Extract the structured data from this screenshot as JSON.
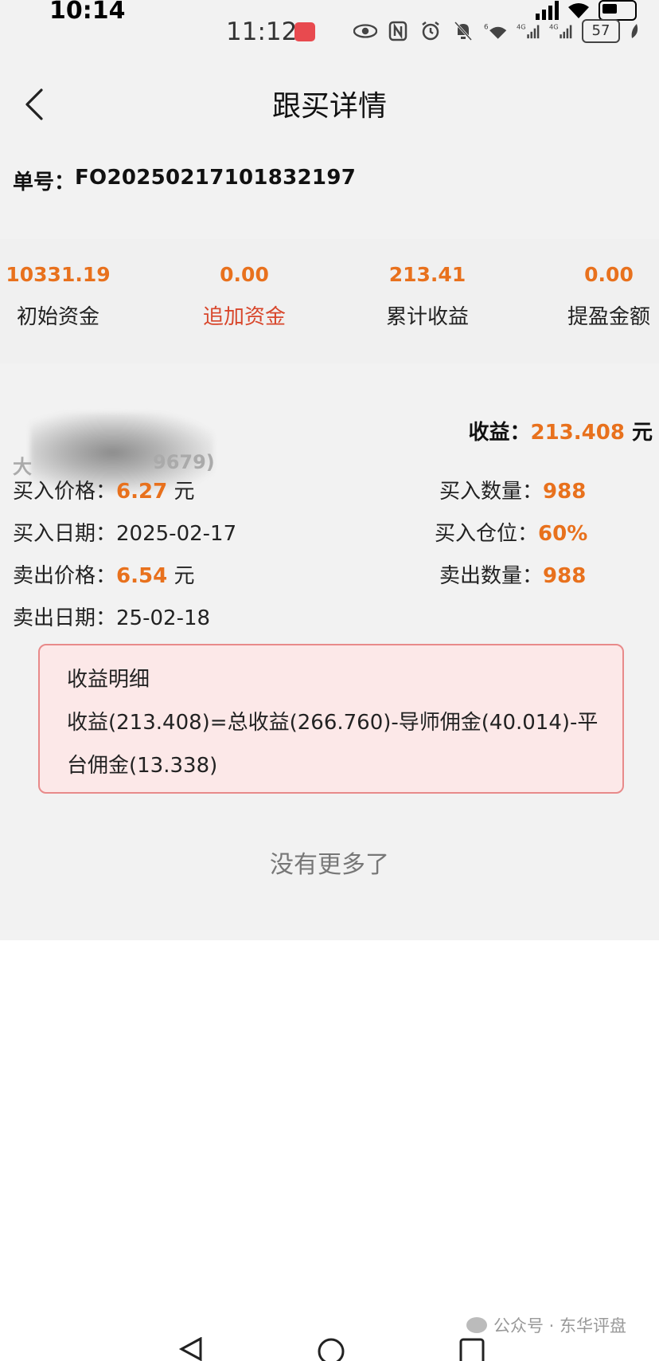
{
  "status_outer": {
    "time": "10:14"
  },
  "status_inner": {
    "time": "11:12",
    "battery": "57",
    "net1": "4G",
    "net2": "4G",
    "wifi_num": "6"
  },
  "header": {
    "title": "跟买详情"
  },
  "order": {
    "label": "单号：",
    "number": "FO20250217101832197"
  },
  "summary": [
    {
      "value": "10331.19",
      "label": "初始资金"
    },
    {
      "value": "0.00",
      "label": "追加资金"
    },
    {
      "value": "213.41",
      "label": "累计收益"
    },
    {
      "value": "0.00",
      "label": "提盈金额"
    }
  ],
  "detail": {
    "stock_name_visible": "大",
    "stock_code_visible": "9679)",
    "profit_label": "收益：",
    "profit_value": "213.408",
    "profit_unit": "元",
    "buy_price_label": "买入价格：",
    "buy_price": "6.27",
    "buy_price_unit": "元",
    "buy_qty_label": "买入数量：",
    "buy_qty": "988",
    "buy_date_label": "买入日期：",
    "buy_date": "2025-02-17",
    "position_label": "买入仓位：",
    "position": "60%",
    "sell_price_label": "卖出价格：",
    "sell_price": "6.54",
    "sell_price_unit": "元",
    "sell_qty_label": "卖出数量：",
    "sell_qty": "988",
    "sell_date_label": "卖出日期：",
    "sell_date": "25-02-18"
  },
  "breakdown": {
    "title": "收益明细",
    "text": "收益(213.408)=总收益(266.760)-导师佣金(40.014)-平台佣金(13.338)"
  },
  "footer": {
    "no_more": "没有更多了"
  },
  "watermark": {
    "text": "公众号 · 东华评盘"
  }
}
